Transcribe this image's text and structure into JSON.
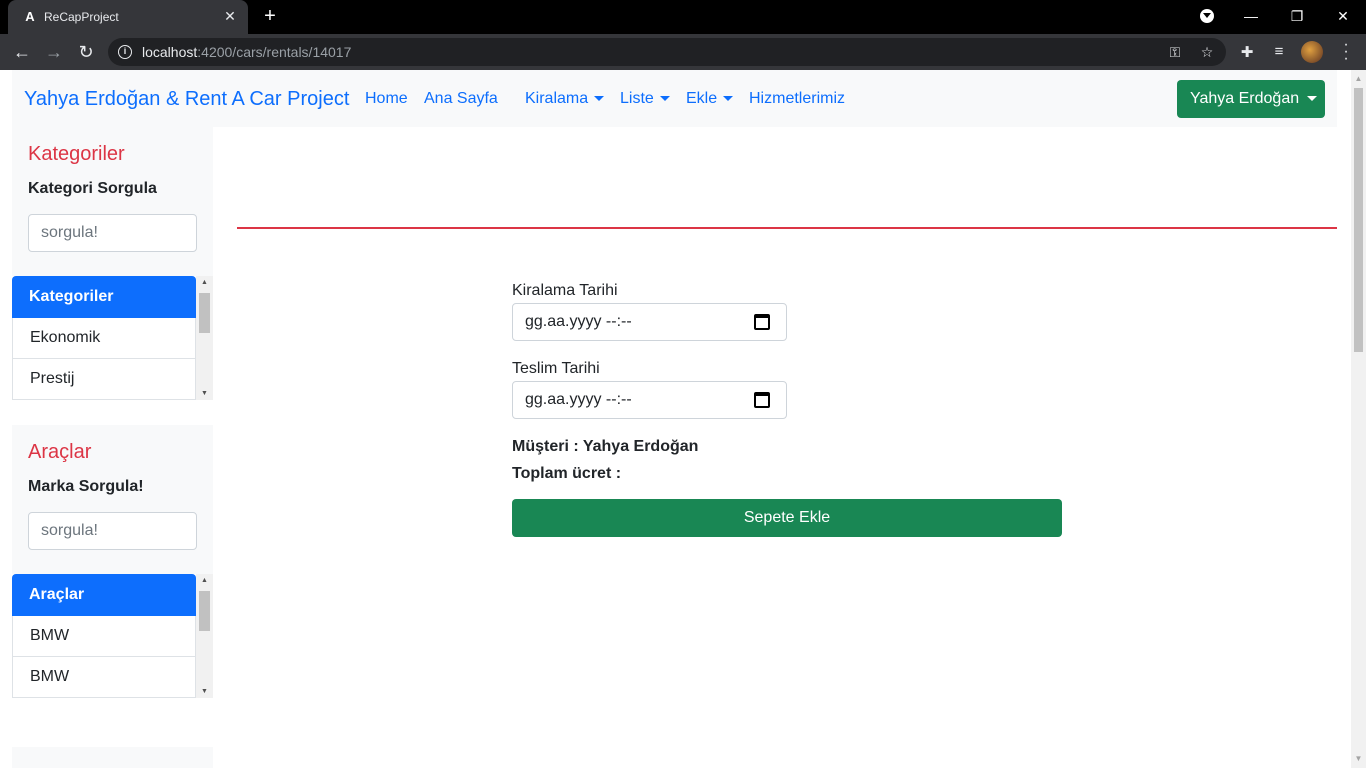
{
  "browser": {
    "tab_title": "ReCapProject",
    "tab_favicon": "A",
    "url_host": "localhost",
    "url_path": ":4200/cars/rentals/14017"
  },
  "navbar": {
    "brand": "Yahya Erdoğan & Rent A Car Project",
    "links": [
      "Home",
      "Ana Sayfa",
      "Kiralama",
      "Liste",
      "Ekle",
      "Hizmetlerimiz"
    ],
    "user_button": "Yahya Erdoğan"
  },
  "categories": {
    "title": "Kategoriler",
    "query_label": "Kategori Sorgula",
    "search_placeholder": "sorgula!",
    "list_header": "Kategoriler",
    "items": [
      "Ekonomik",
      "Prestij"
    ]
  },
  "cars": {
    "title": "Araçlar",
    "query_label": "Marka Sorgula!",
    "search_placeholder": "sorgula!",
    "list_header": "Araçlar",
    "items": [
      "BMW",
      "BMW"
    ]
  },
  "form": {
    "rental_date_label": "Kiralama Tarihi",
    "rental_date_value": "gg.aa.yyyy --:--",
    "return_date_label": "Teslim Tarihi",
    "return_date_value": "gg.aa.yyyy --:--",
    "customer": "Müşteri : Yahya Erdoğan",
    "total": "Toplam ücret :",
    "submit": "Sepete Ekle"
  },
  "colors": {
    "primary": "#0d6efd",
    "success": "#198754",
    "danger": "#dc3545"
  }
}
